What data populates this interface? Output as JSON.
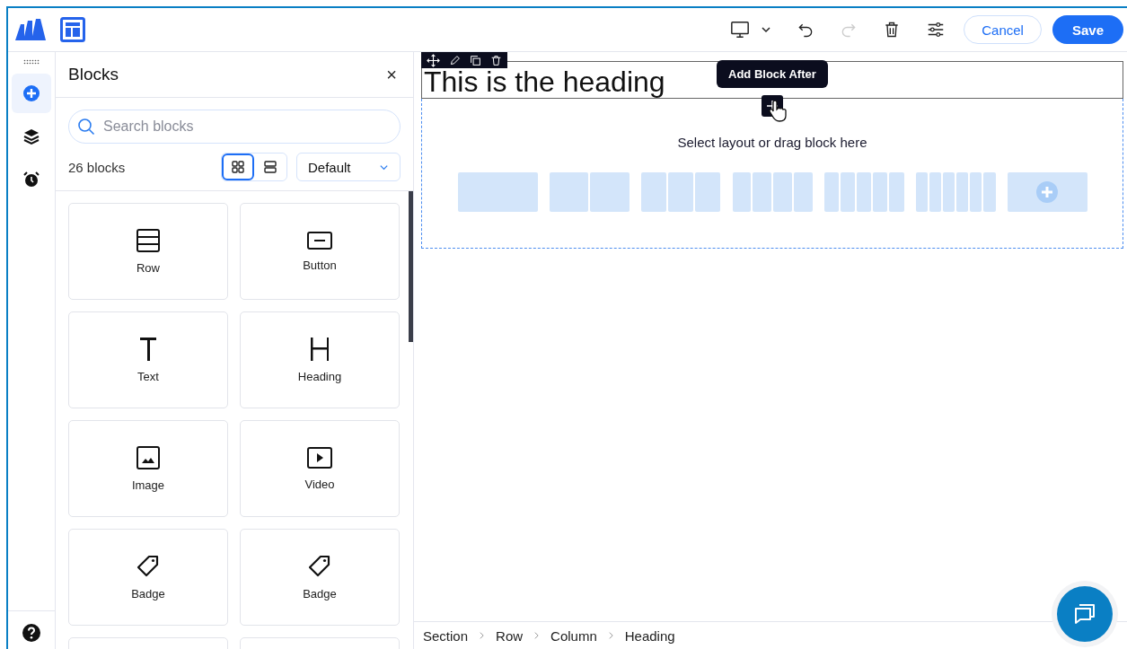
{
  "toolbar": {
    "cancel": "Cancel",
    "save": "Save",
    "redo_disabled": true
  },
  "rail": [
    {
      "kind": "add",
      "selected": true
    },
    {
      "kind": "layers",
      "selected": false
    },
    {
      "kind": "alarm",
      "selected": false
    }
  ],
  "panel": {
    "title": "Blocks",
    "close": "×",
    "search": {
      "placeholder": "Search blocks"
    },
    "count": "26 blocks",
    "views": [
      {
        "kind": "grid",
        "selected": true
      },
      {
        "kind": "list",
        "selected": false
      }
    ],
    "sort": "Default",
    "blocks": [
      {
        "kind": "row",
        "label": "Row"
      },
      {
        "kind": "button",
        "label": "Button"
      },
      {
        "kind": "text",
        "label": "Text"
      },
      {
        "kind": "heading",
        "label": "Heading"
      },
      {
        "kind": "image",
        "label": "Image"
      },
      {
        "kind": "video",
        "label": "Video"
      },
      {
        "kind": "badge",
        "label": "Badge"
      },
      {
        "kind": "badge",
        "label": "Badge"
      }
    ]
  },
  "canvas": {
    "heading": "This is the heading",
    "tooltip": "Add Block After",
    "drop_hint": "Select layout or drag block here",
    "layouts": [
      {
        "kind": "one"
      },
      {
        "kind": "two"
      },
      {
        "kind": "three"
      },
      {
        "kind": "four"
      },
      {
        "kind": "five"
      },
      {
        "kind": "six"
      },
      {
        "kind": "custom"
      }
    ]
  },
  "breadcrumb": [
    "Section",
    "Row",
    "Column",
    "Heading"
  ]
}
